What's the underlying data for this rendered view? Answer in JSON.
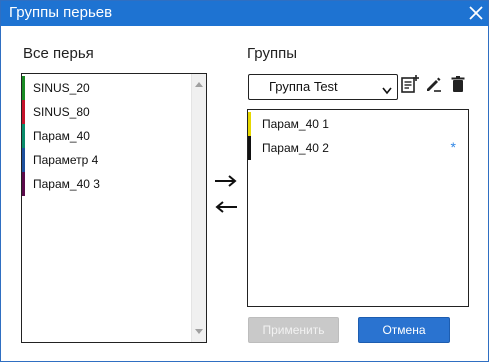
{
  "window": {
    "title": "Группы перьев"
  },
  "all_pens": {
    "label": "Все перья",
    "items": [
      {
        "label": "SINUS_20",
        "color": "#1a8a24"
      },
      {
        "label": "SINUS_80",
        "color": "#c4122a"
      },
      {
        "label": "Парам_40",
        "color": "#0a8a6a"
      },
      {
        "label": "Параметр 4",
        "color": "#1d4f9c"
      },
      {
        "label": "Парам_40 3",
        "color": "#5a0a4a"
      }
    ]
  },
  "transfer": {
    "add_icon": "arrow-right-icon",
    "remove_icon": "arrow-left-icon"
  },
  "groups": {
    "label": "Группы",
    "selected_group": "Группа Test",
    "toolbar": {
      "add_icon": "add-note-icon",
      "rename_icon": "edit-pen-icon",
      "delete_icon": "trash-icon"
    },
    "items": [
      {
        "label": "Парам_40 1",
        "color": "#e6d800",
        "marker": ""
      },
      {
        "label": "Парам_40 2",
        "color": "#111111",
        "marker": "*"
      }
    ]
  },
  "buttons": {
    "apply": "Применить",
    "cancel": "Отмена"
  },
  "colors": {
    "titlebar": "#1e73d2",
    "accent": "#2a73d0"
  }
}
